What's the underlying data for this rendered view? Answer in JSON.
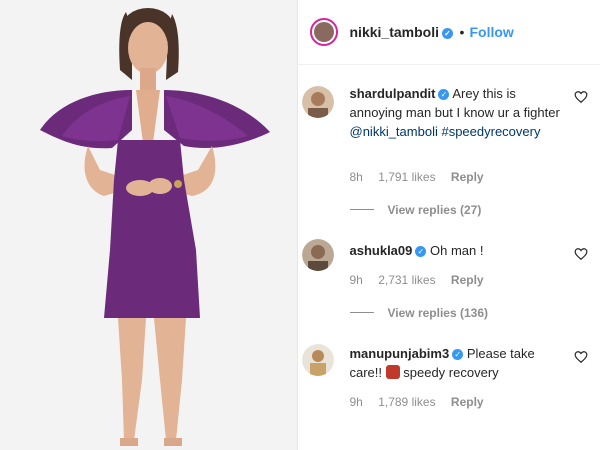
{
  "header": {
    "username": "nikki_tamboli",
    "separator": "•",
    "follow_label": "Follow"
  },
  "comments": [
    {
      "username": "shardulpandit",
      "text": "Arey this is annoying man but I know ur a fighter",
      "mention": "@nikki_tamboli",
      "hashtag": "#speedyrecovery",
      "time": "8h",
      "likes": "1,791 likes",
      "reply_label": "Reply",
      "view_replies": "View replies (27)"
    },
    {
      "username": "ashukla09",
      "text": "Oh man !",
      "time": "9h",
      "likes": "2,731 likes",
      "reply_label": "Reply",
      "view_replies": "View replies (136)"
    },
    {
      "username": "manupunjabim3",
      "text": "Please take care!!",
      "text_after_emoji": "speedy recovery",
      "time": "9h",
      "likes": "1,789 likes",
      "reply_label": "Reply"
    }
  ],
  "colors": {
    "accent": "#3897f0",
    "dress": "#6b2a7a",
    "muted": "#8e8e8e"
  },
  "icons": [
    "verified-badge-icon",
    "heart-icon"
  ]
}
